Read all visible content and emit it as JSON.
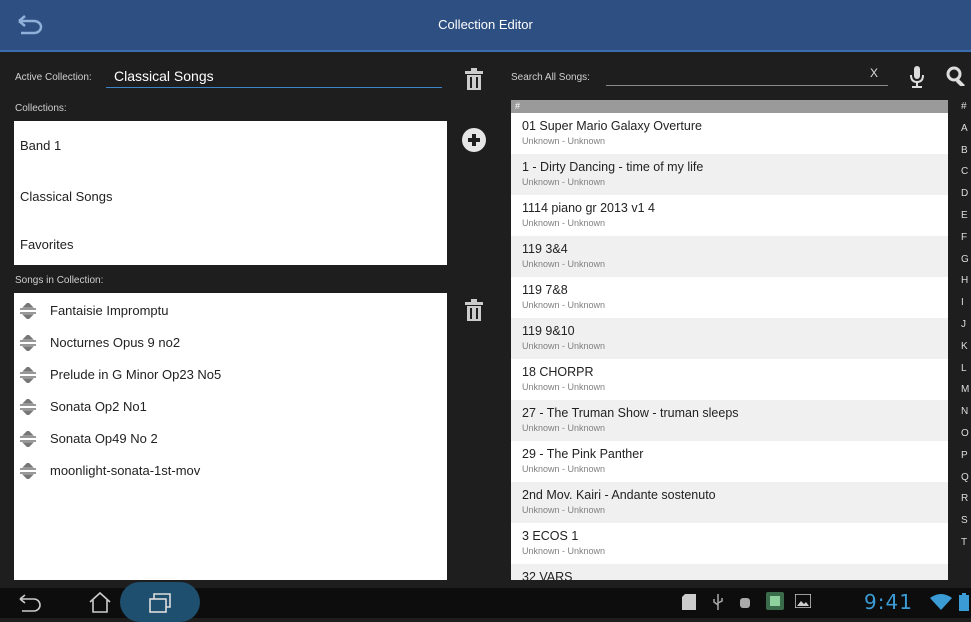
{
  "titlebar": {
    "title": "Collection Editor"
  },
  "left": {
    "active_label": "Active Collection:",
    "active_value": "Classical Songs",
    "collections_label": "Collections:",
    "collections": [
      "Band 1",
      "Classical Songs",
      "Favorites"
    ],
    "songs_label": "Songs in Collection:",
    "songs": [
      "Fantaisie Impromptu",
      "Nocturnes Opus 9 no2",
      "Prelude in G Minor Op23 No5",
      "Sonata Op2 No1",
      "Sonata Op49 No 2",
      "moonlight-sonata-1st-mov"
    ]
  },
  "search": {
    "label": "Search All Songs:",
    "clear": "X"
  },
  "list": {
    "header": "#",
    "items": [
      {
        "title": "01 Super Mario Galaxy Overture",
        "sub": "Unknown - Unknown"
      },
      {
        "title": "1 - Dirty Dancing - time of my life",
        "sub": "Unknown - Unknown"
      },
      {
        "title": "1114 piano gr 2013 v1 4",
        "sub": "Unknown - Unknown"
      },
      {
        "title": "119 3&4",
        "sub": "Unknown - Unknown"
      },
      {
        "title": "119 7&8",
        "sub": "Unknown - Unknown"
      },
      {
        "title": "119 9&10",
        "sub": "Unknown - Unknown"
      },
      {
        "title": "18 CHORPR",
        "sub": "Unknown - Unknown"
      },
      {
        "title": "27 - The Truman Show - truman sleeps",
        "sub": "Unknown - Unknown"
      },
      {
        "title": "29 - The Pink Panther",
        "sub": "Unknown - Unknown"
      },
      {
        "title": "2nd Mov. Kairi - Andante sostenuto",
        "sub": "Unknown - Unknown"
      },
      {
        "title": "3 ECOS 1",
        "sub": "Unknown - Unknown"
      },
      {
        "title": "32 VARS",
        "sub": ""
      }
    ]
  },
  "alpha_index": [
    "#",
    "A",
    "B",
    "C",
    "D",
    "E",
    "F",
    "G",
    "H",
    "I",
    "J",
    "K",
    "L",
    "M",
    "N",
    "O",
    "P",
    "Q",
    "R",
    "S",
    "T"
  ],
  "status": {
    "clock": "9:41"
  },
  "colors": {
    "accent": "#3b9bd4",
    "titlebar": "#2e4f82"
  }
}
